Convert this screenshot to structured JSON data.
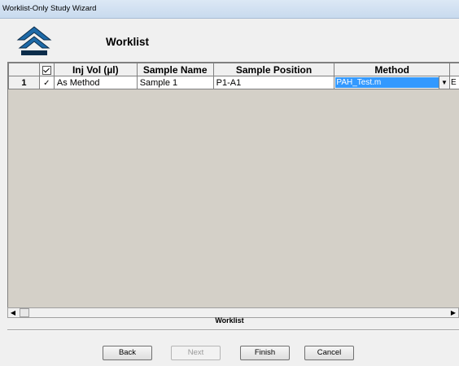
{
  "window": {
    "title": "Worklist-Only Study Wizard"
  },
  "header": {
    "title": "Worklist",
    "logo_icon": "double-chevron-up-logo-icon"
  },
  "grid": {
    "columns": [
      "Inj Vol (µl)",
      "Sample Name",
      "Sample Position",
      "Method"
    ],
    "rows": [
      {
        "number": "1",
        "inj_vol": "As Method",
        "sample_name": "Sample 1",
        "sample_position": "P1-A1",
        "method": "PAH_Test.m",
        "next_col_fragment": "E"
      }
    ]
  },
  "footer": {
    "caption": "Worklist"
  },
  "buttons": {
    "back": "Back",
    "next": "Next",
    "finish": "Finish",
    "cancel": "Cancel"
  },
  "colors": {
    "selection": "#3399ff",
    "grid_background": "#d4d0c8",
    "logo": "#1e6aa8"
  }
}
